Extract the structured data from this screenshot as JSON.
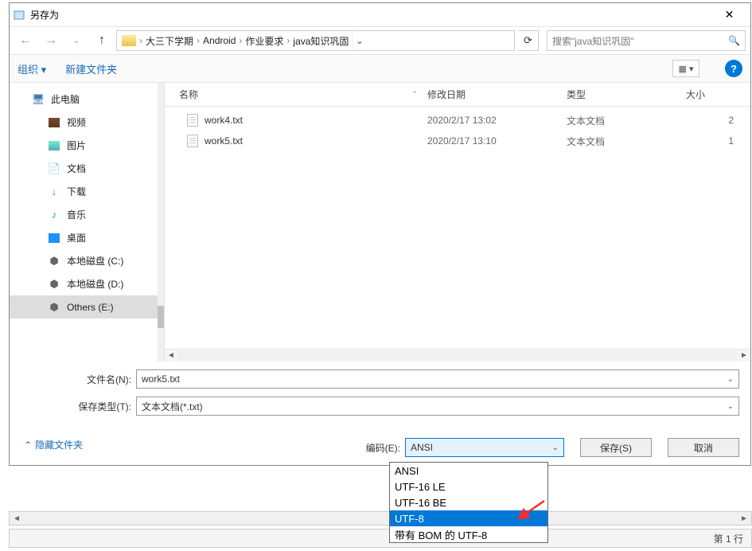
{
  "window": {
    "title": "另存为"
  },
  "breadcrumb": {
    "parts": [
      "大三下学期",
      "Android",
      "作业要求",
      "java知识巩固"
    ]
  },
  "search": {
    "placeholder": "搜索\"java知识巩固\""
  },
  "toolbar": {
    "organize": "组织",
    "newfolder": "新建文件夹"
  },
  "sidebar": {
    "pc": "此电脑",
    "video": "视频",
    "pics": "图片",
    "docs": "文档",
    "downloads": "下载",
    "music": "音乐",
    "desktop": "桌面",
    "diskc": "本地磁盘 (C:)",
    "diskd": "本地磁盘 (D:)",
    "others": "Others (E:)"
  },
  "columns": {
    "name": "名称",
    "date": "修改日期",
    "type": "类型",
    "size": "大小"
  },
  "files": [
    {
      "name": "work4.txt",
      "date": "2020/2/17 13:02",
      "type": "文本文档",
      "size": "2"
    },
    {
      "name": "work5.txt",
      "date": "2020/2/17 13:10",
      "type": "文本文档",
      "size": "1"
    }
  ],
  "form": {
    "filename_label": "文件名(N):",
    "filename_value": "work5.txt",
    "savetype_label": "保存类型(T):",
    "savetype_value": "文本文档(*.txt)",
    "encoding_label": "编码(E):",
    "encoding_value": "ANSI",
    "hide_label": "隐藏文件夹",
    "save_label": "保存(S)",
    "cancel_label": "取消"
  },
  "encoding_options": [
    "ANSI",
    "UTF-16 LE",
    "UTF-16 BE",
    "UTF-8",
    "带有 BOM 的 UTF-8"
  ],
  "encoding_selected_index": 3,
  "status": {
    "line": "第 1 行"
  }
}
